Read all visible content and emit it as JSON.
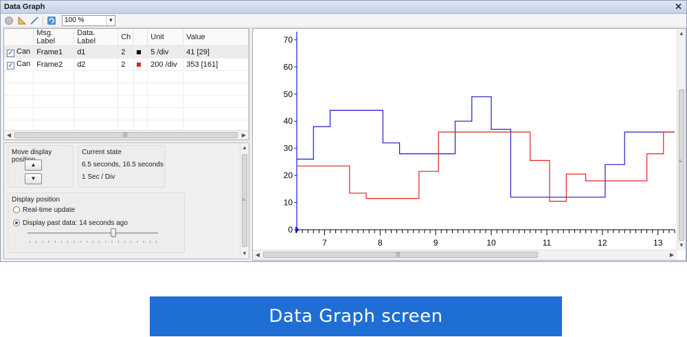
{
  "window": {
    "title": "Data Graph",
    "close_glyph": "✕"
  },
  "toolbar": {
    "icons": [
      "record-icon",
      "ruler-icon",
      "line-icon",
      "refresh-icon"
    ],
    "zoom_value": "100 %"
  },
  "grid": {
    "columns": [
      "",
      "Msg. Label",
      "Data. Label",
      "Ch",
      "",
      "Unit",
      "Value"
    ],
    "rows": [
      {
        "checked": true,
        "type": "Can",
        "msg_label": "Frame1",
        "data_label": "d1",
        "ch": "2",
        "color": "#000000",
        "unit": "5 /div",
        "value": "41 [29]"
      },
      {
        "checked": true,
        "type": "Can",
        "msg_label": "Frame2",
        "data_label": "d2",
        "ch": "2",
        "color": "#e02020",
        "unit": "200 /div",
        "value": "353 [161]"
      }
    ]
  },
  "controls": {
    "move_title": "Move display position",
    "current_state_title": "Current state",
    "current_state_time": "6.5 seconds, 16.5 seconds",
    "current_state_scale": "1 Sec / Div",
    "display_position_title": "Display position",
    "realtime_label": "Real-time update",
    "past_label": "Display past data: 14 seconds ago",
    "selected_option": "past",
    "slider_fraction": 0.66
  },
  "chart_data": {
    "type": "line",
    "title": "",
    "xlabel": "",
    "ylabel": "",
    "xlim": [
      6.5,
      13.3
    ],
    "ylim": [
      0,
      72
    ],
    "x_ticks": [
      7,
      8,
      9,
      10,
      11,
      12,
      13
    ],
    "y_ticks": [
      0,
      10,
      20,
      30,
      40,
      50,
      60,
      70
    ],
    "step": true,
    "series": [
      {
        "color": "#1a1ad0",
        "points": [
          [
            6.5,
            26
          ],
          [
            6.8,
            26
          ],
          [
            6.8,
            38
          ],
          [
            7.1,
            38
          ],
          [
            7.1,
            44
          ],
          [
            8.05,
            44
          ],
          [
            8.05,
            32
          ],
          [
            8.35,
            32
          ],
          [
            8.35,
            28
          ],
          [
            9.35,
            28
          ],
          [
            9.35,
            40
          ],
          [
            9.65,
            40
          ],
          [
            9.65,
            49
          ],
          [
            10.0,
            49
          ],
          [
            10.0,
            37
          ],
          [
            10.35,
            37
          ],
          [
            10.35,
            12
          ],
          [
            12.05,
            12
          ],
          [
            12.05,
            24
          ],
          [
            12.4,
            24
          ],
          [
            12.4,
            36
          ],
          [
            13.3,
            36
          ]
        ]
      },
      {
        "color": "#e02020",
        "points": [
          [
            6.5,
            23.5
          ],
          [
            7.45,
            23.5
          ],
          [
            7.45,
            13.5
          ],
          [
            7.75,
            13.5
          ],
          [
            7.75,
            11.5
          ],
          [
            8.7,
            11.5
          ],
          [
            8.7,
            21.5
          ],
          [
            9.05,
            21.5
          ],
          [
            9.05,
            36
          ],
          [
            10.7,
            36
          ],
          [
            10.7,
            25.5
          ],
          [
            11.05,
            25.5
          ],
          [
            11.05,
            10.5
          ],
          [
            11.35,
            10.5
          ],
          [
            11.35,
            20.5
          ],
          [
            11.7,
            20.5
          ],
          [
            11.7,
            18
          ],
          [
            12.8,
            18
          ],
          [
            12.8,
            28
          ],
          [
            13.1,
            28
          ],
          [
            13.1,
            36
          ],
          [
            13.3,
            36
          ]
        ]
      }
    ],
    "cursor_marker_color": "#1a1ad0"
  },
  "caption": "Data Graph screen"
}
